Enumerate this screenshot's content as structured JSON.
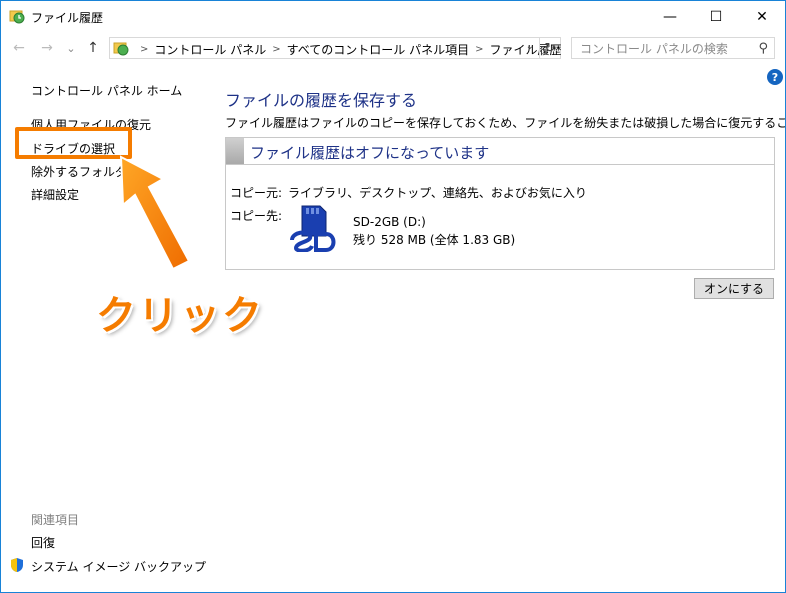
{
  "window": {
    "title": "ファイル履歴",
    "minimize": "—",
    "maximize": "☐",
    "close": "✕"
  },
  "nav": {
    "back": "←",
    "forward": "→",
    "recent": "⌄",
    "up": "↑",
    "breadcrumbs": [
      "コントロール パネル",
      "すべてのコントロール パネル項目",
      "ファイル履歴"
    ],
    "breadcrumb_sep": ">",
    "dropdown": "⌄",
    "refresh": "↻"
  },
  "search": {
    "placeholder": "コントロール パネルの検索",
    "icon": "⚲"
  },
  "help": "?",
  "sidebar": {
    "items": [
      {
        "label": "コントロール パネル ホーム"
      },
      {
        "label": "個人用ファイルの復元"
      },
      {
        "label": "ドライブの選択"
      },
      {
        "label": "除外するフォルダー"
      },
      {
        "label": "詳細設定"
      }
    ],
    "related_heading": "関連項目",
    "related_items": [
      {
        "label": "回復"
      },
      {
        "label": "システム イメージ バックアップ"
      }
    ]
  },
  "annotation": {
    "click_text": "クリック",
    "color": "#f57c00"
  },
  "main": {
    "title": "ファイルの履歴を保存する",
    "description": "ファイル履歴はファイルのコピーを保存しておくため、ファイルを紛失または破損した場合に復元することができます。",
    "status_title": "ファイル履歴はオフになっています",
    "copy_from_label": "コピー元:",
    "copy_from_value": "ライブラリ、デスクトップ、連絡先、およびお気に入り",
    "copy_to_label": "コピー先:",
    "drive_name": "SD-2GB (D:)",
    "drive_space": "残り 528 MB (全体 1.83 GB)",
    "turn_on_button": "オンにする"
  },
  "colors": {
    "heading_blue": "#1e3287",
    "window_border": "#1883d7",
    "annotation_orange": "#f57c00"
  }
}
